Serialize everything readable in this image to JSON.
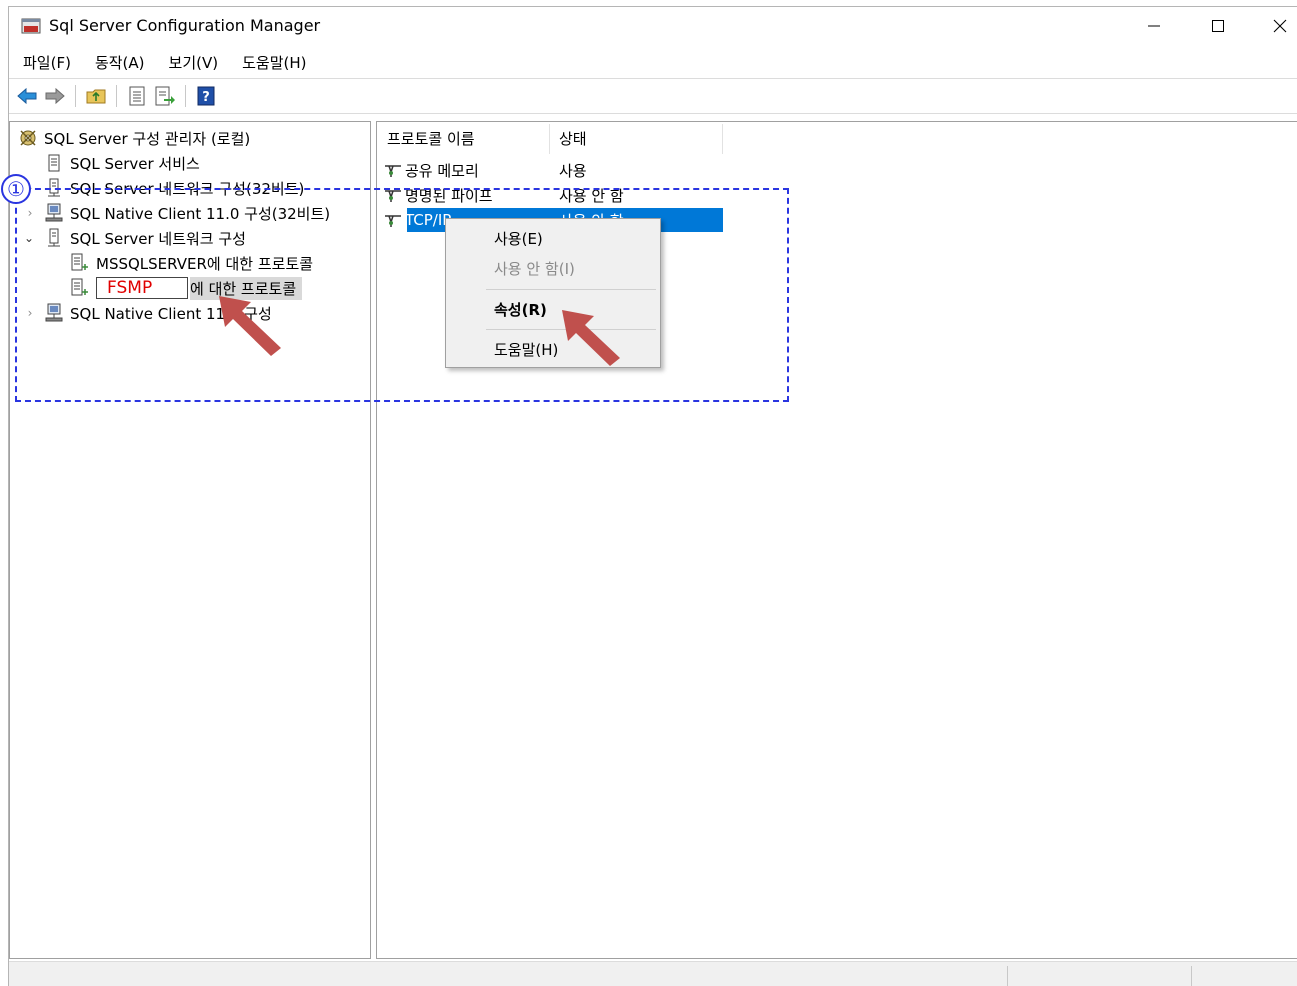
{
  "window": {
    "title": "Sql Server Configuration Manager",
    "controls": {
      "minimize": "—",
      "maximize": "☐",
      "close": "✕"
    }
  },
  "menu": [
    "파일(F)",
    "동작(A)",
    "보기(V)",
    "도움말(H)"
  ],
  "toolbar": [
    "back-arrow-icon",
    "forward-arrow-icon",
    "up-folder-icon",
    "properties-icon",
    "export-list-icon",
    "help-icon"
  ],
  "tree": {
    "root": "SQL Server 구성 관리자 (로컬)",
    "items": [
      "SQL Server 서비스",
      "SQL Server 네트워크 구성(32비트)",
      "SQL Native Client 11.0 구성(32비트)",
      "SQL Server 네트워크 구성",
      "MSSQLSERVER에 대한 프로토콜",
      "에 대한 프로토콜",
      "SQL Native Client 11.0 구성"
    ],
    "selected_overlay_text": "FSMP",
    "selected_prefix_visible": "FSMP",
    "native_client_visible_left": "SQL Native Client 1",
    "native_client_visible_right": "구성"
  },
  "list": {
    "columns": [
      "프로토콜 이름",
      "상태"
    ],
    "rows": [
      {
        "name": "공유 메모리",
        "status": "사용"
      },
      {
        "name": "명명된 파이프",
        "status": "사용 안 함"
      },
      {
        "name": "TCP/IP",
        "status": "사용 안 함"
      }
    ],
    "selected_index": 2
  },
  "context_menu": {
    "items": [
      {
        "label": "사용(E)",
        "enabled": true
      },
      {
        "label": "사용 안 함(I)",
        "enabled": false
      },
      {
        "label": "속성(R)",
        "enabled": true,
        "bold": true
      },
      {
        "label": "도움말(H)",
        "enabled": true
      }
    ]
  },
  "annotation": {
    "step_number": "①",
    "box_color": "#2a35e0",
    "arrow_color": "#c0504d"
  },
  "colors": {
    "selection": "#0078d7",
    "instance_label": "#e00000"
  }
}
